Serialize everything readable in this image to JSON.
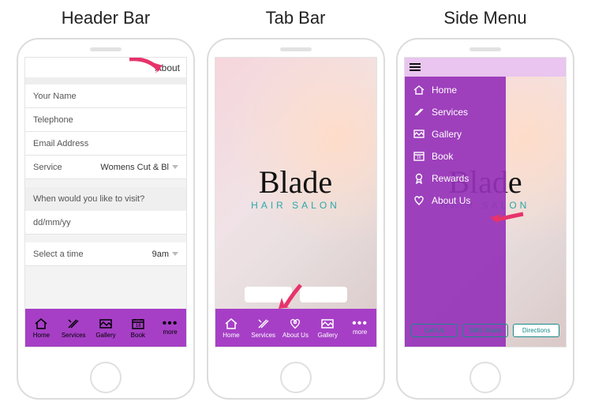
{
  "titles": {
    "col1": "Header Bar",
    "col2": "Tab Bar",
    "col3": "Side Menu"
  },
  "screen1": {
    "header_link": "About",
    "fields": {
      "name": "Your Name",
      "tel": "Telephone",
      "email": "Email Address",
      "service_label": "Service",
      "service_value": "Womens Cut & Bl",
      "visit_q": "When would you like to visit?",
      "date_placeholder": "dd/mm/yy",
      "time_label": "Select a time",
      "time_value": "9am"
    },
    "tabs": {
      "home": "Home",
      "services": "Services",
      "gallery": "Gallery",
      "book": "Book",
      "more": "more"
    }
  },
  "screen2": {
    "logo_main": "Blade",
    "logo_sub": "HAIR SALON",
    "tabs": {
      "home": "Home",
      "services": "Services",
      "about": "About Us",
      "gallery": "Gallery",
      "more": "more"
    }
  },
  "screen3": {
    "logo_main": "Blade",
    "logo_sub": "HAIR SALON",
    "menu": {
      "home": "Home",
      "services": "Services",
      "gallery": "Gallery",
      "book": "Book",
      "rewards": "Rewards",
      "about": "About Us"
    },
    "buttons": {
      "call": "Call Us",
      "sms": "SMS Share",
      "dir": "Directions"
    }
  },
  "colors": {
    "purple": "#a63fc6",
    "teal": "#1a8a8a",
    "arrow": "#e6336b"
  }
}
